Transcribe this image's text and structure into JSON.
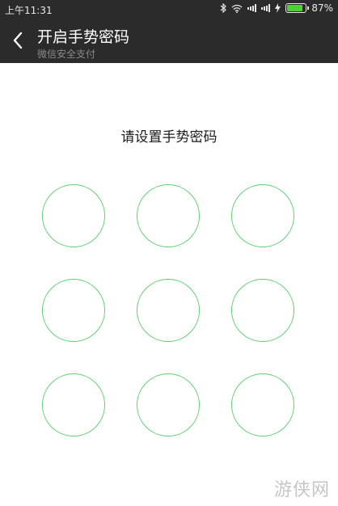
{
  "status_bar": {
    "time": "上午11:31",
    "battery_percent": "87%",
    "battery_level": 0.87,
    "icons": [
      "bluetooth-icon",
      "wifi-icon",
      "signal-icon",
      "signal-icon",
      "charging-icon",
      "battery-icon"
    ]
  },
  "header": {
    "back_icon": "chevron-left-icon",
    "title": "开启手势密码",
    "subtitle": "微信安全支付"
  },
  "main": {
    "prompt": "请设置手势密码",
    "pattern_dot_count": 9,
    "ring_color": "#5fcf73"
  },
  "watermark": "游侠网"
}
